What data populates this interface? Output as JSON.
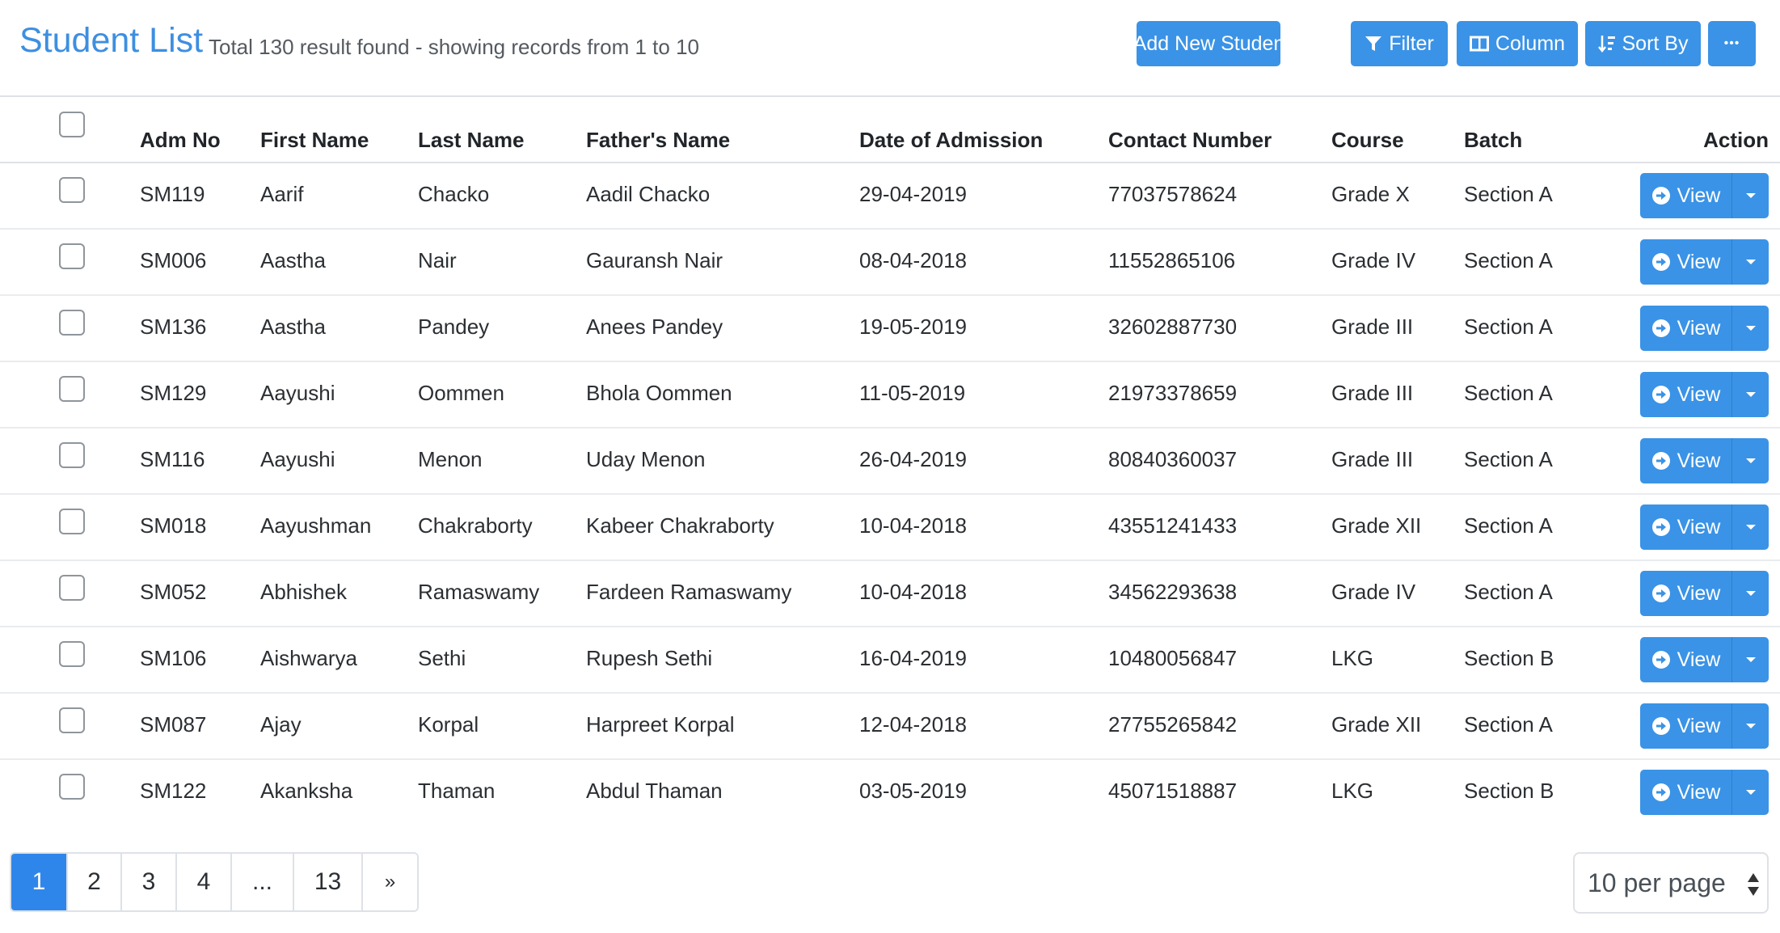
{
  "header": {
    "title": "Student List",
    "subtitle": "Total 130 result found - showing records from 1 to 10"
  },
  "toolbar": {
    "add_label": "Add New Student",
    "filter_label": "Filter",
    "column_label": "Column",
    "sort_label": "Sort By",
    "more_label": "•••"
  },
  "table": {
    "headers": {
      "adm_no": "Adm No",
      "first_name": "First Name",
      "last_name": "Last Name",
      "father_name": "Father's Name",
      "date": "Date of Admission",
      "contact": "Contact Number",
      "course": "Course",
      "batch": "Batch",
      "action": "Action"
    },
    "view_label": "View",
    "rows": [
      {
        "adm": "SM119",
        "first": "Aarif",
        "last": "Chacko",
        "father": "Aadil Chacko",
        "date": "29-04-2019",
        "contact": "77037578624",
        "course": "Grade X",
        "batch": "Section A"
      },
      {
        "adm": "SM006",
        "first": "Aastha",
        "last": "Nair",
        "father": "Gauransh Nair",
        "date": "08-04-2018",
        "contact": "11552865106",
        "course": "Grade IV",
        "batch": "Section A"
      },
      {
        "adm": "SM136",
        "first": "Aastha",
        "last": "Pandey",
        "father": "Anees Pandey",
        "date": "19-05-2019",
        "contact": "32602887730",
        "course": "Grade III",
        "batch": "Section A"
      },
      {
        "adm": "SM129",
        "first": "Aayushi",
        "last": "Oommen",
        "father": "Bhola Oommen",
        "date": "11-05-2019",
        "contact": "21973378659",
        "course": "Grade III",
        "batch": "Section A"
      },
      {
        "adm": "SM116",
        "first": "Aayushi",
        "last": "Menon",
        "father": "Uday Menon",
        "date": "26-04-2019",
        "contact": "80840360037",
        "course": "Grade III",
        "batch": "Section A"
      },
      {
        "adm": "SM018",
        "first": "Aayushman",
        "last": "Chakraborty",
        "father": "Kabeer Chakraborty",
        "date": "10-04-2018",
        "contact": "43551241433",
        "course": "Grade XII",
        "batch": "Section A"
      },
      {
        "adm": "SM052",
        "first": "Abhishek",
        "last": "Ramaswamy",
        "father": "Fardeen Ramaswamy",
        "date": "10-04-2018",
        "contact": "34562293638",
        "course": "Grade IV",
        "batch": "Section A"
      },
      {
        "adm": "SM106",
        "first": "Aishwarya",
        "last": "Sethi",
        "father": "Rupesh Sethi",
        "date": "16-04-2019",
        "contact": "10480056847",
        "course": "LKG",
        "batch": "Section B"
      },
      {
        "adm": "SM087",
        "first": "Ajay",
        "last": "Korpal",
        "father": "Harpreet Korpal",
        "date": "12-04-2018",
        "contact": "27755265842",
        "course": "Grade XII",
        "batch": "Section A"
      },
      {
        "adm": "SM122",
        "first": "Akanksha",
        "last": "Thaman",
        "father": "Abdul Thaman",
        "date": "03-05-2019",
        "contact": "45071518887",
        "course": "LKG",
        "batch": "Section B"
      }
    ]
  },
  "pagination": {
    "pages": [
      "1",
      "2",
      "3",
      "4",
      "...",
      "13",
      "»"
    ],
    "active": "1",
    "per_page": "10 per page"
  },
  "colors": {
    "accent": "#3a93e6",
    "title": "#3d8fe0",
    "active_page": "#2f86ea"
  }
}
